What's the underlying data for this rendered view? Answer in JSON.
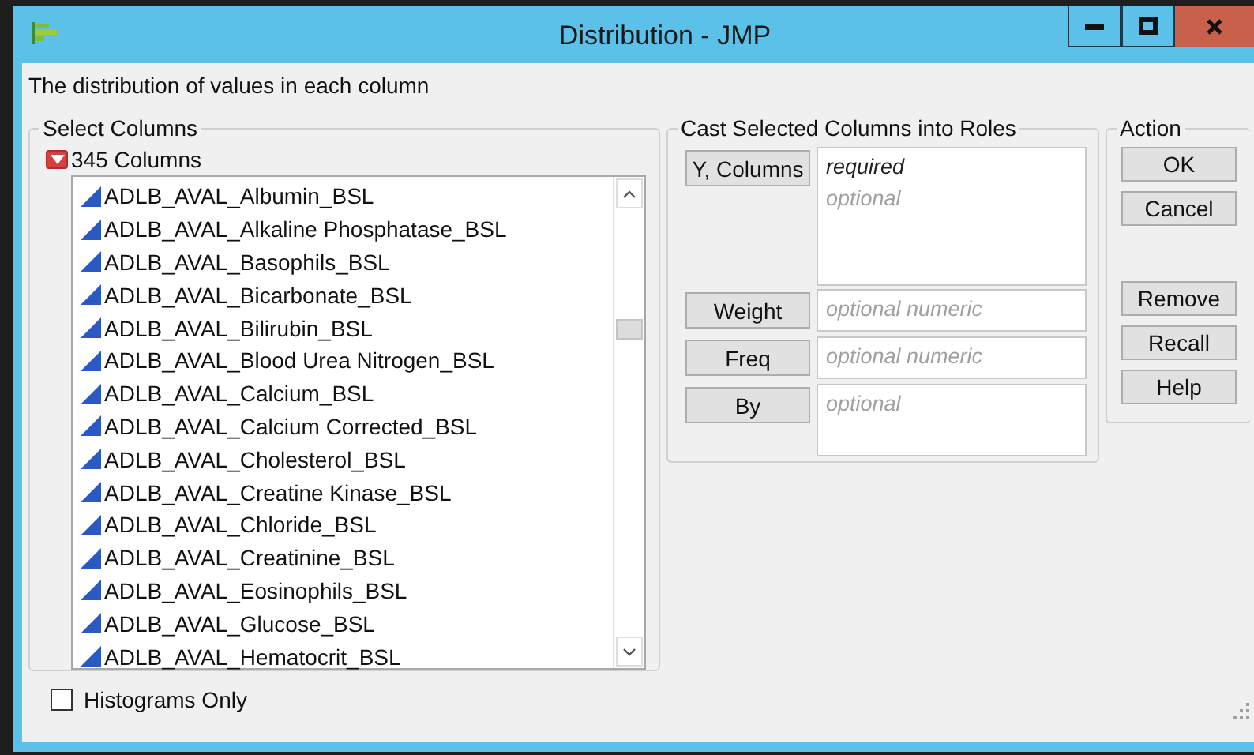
{
  "window": {
    "title": "Distribution - JMP"
  },
  "description": "The distribution of values in each column",
  "select_columns": {
    "legend": "Select Columns",
    "count_label": "345 Columns",
    "columns": [
      {
        "name": "ADLB_AVAL_Albumin_BSL",
        "kind": "continuous"
      },
      {
        "name": "ADLB_AVAL_Alkaline Phosphatase_BSL",
        "kind": "continuous"
      },
      {
        "name": "ADLB_AVAL_Basophils_BSL",
        "kind": "continuous"
      },
      {
        "name": "ADLB_AVAL_Bicarbonate_BSL",
        "kind": "continuous"
      },
      {
        "name": "ADLB_AVAL_Bilirubin_BSL",
        "kind": "continuous"
      },
      {
        "name": "ADLB_AVAL_Blood Urea Nitrogen_BSL",
        "kind": "continuous"
      },
      {
        "name": "ADLB_AVAL_Calcium_BSL",
        "kind": "continuous"
      },
      {
        "name": "ADLB_AVAL_Calcium Corrected_BSL",
        "kind": "continuous"
      },
      {
        "name": "ADLB_AVAL_Cholesterol_BSL",
        "kind": "continuous"
      },
      {
        "name": "ADLB_AVAL_Creatine Kinase_BSL",
        "kind": "continuous"
      },
      {
        "name": "ADLB_AVAL_Chloride_BSL",
        "kind": "continuous"
      },
      {
        "name": "ADLB_AVAL_Creatinine_BSL",
        "kind": "continuous"
      },
      {
        "name": "ADLB_AVAL_Eosinophils_BSL",
        "kind": "continuous"
      },
      {
        "name": "ADLB_AVAL_Glucose_BSL",
        "kind": "continuous"
      },
      {
        "name": "ADLB_AVAL_Hematocrit_BSL",
        "kind": "continuous"
      }
    ]
  },
  "cast_roles": {
    "legend": "Cast Selected Columns into Roles",
    "roles": [
      {
        "button": "Y, Columns",
        "kind": "tall",
        "hints": [
          {
            "text": "required",
            "kind": "required"
          },
          {
            "text": "optional",
            "kind": "optional"
          }
        ]
      },
      {
        "button": "Weight",
        "kind": "short",
        "hints": [
          {
            "text": "optional numeric",
            "kind": "optional"
          }
        ]
      },
      {
        "button": "Freq",
        "kind": "short",
        "hints": [
          {
            "text": "optional numeric",
            "kind": "optional"
          }
        ]
      },
      {
        "button": "By",
        "kind": "medium",
        "hints": [
          {
            "text": "optional",
            "kind": "optional"
          }
        ]
      }
    ]
  },
  "action": {
    "legend": "Action",
    "groups": [
      [
        "OK",
        "Cancel"
      ],
      [
        "Remove",
        "Recall",
        "Help"
      ]
    ]
  },
  "histograms_only": {
    "label": "Histograms Only",
    "checked": false
  }
}
